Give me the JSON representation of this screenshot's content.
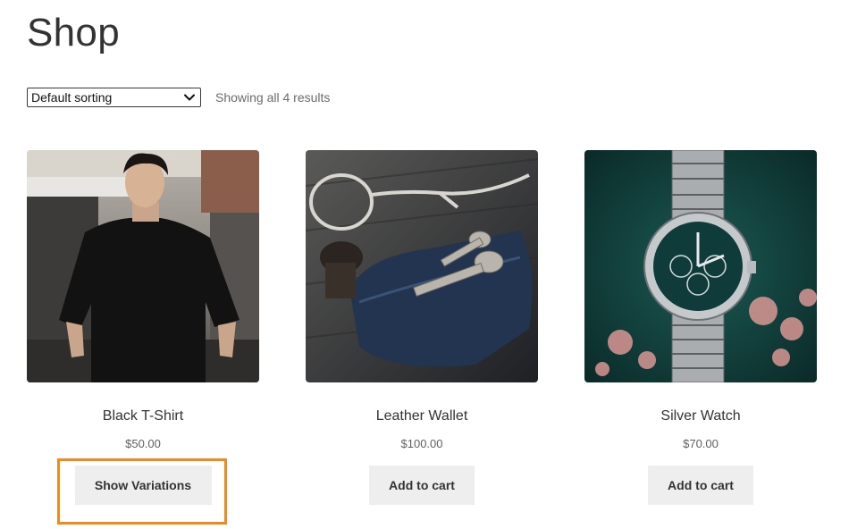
{
  "page": {
    "title": "Shop"
  },
  "toolbar": {
    "sort_selected": "Default sorting",
    "result_count": "Showing all 4 results"
  },
  "products": [
    {
      "name": "Black T-Shirt",
      "price": "$50.00",
      "button_label": "Show Variations"
    },
    {
      "name": "Leather Wallet",
      "price": "$100.00",
      "button_label": "Add to cart"
    },
    {
      "name": "Silver Watch",
      "price": "$70.00",
      "button_label": "Add to cart"
    }
  ],
  "colors": {
    "highlight": "#f08a1c",
    "button_bg": "#eeeeee",
    "text": "#333333"
  },
  "icons": {
    "select": "chevron-down-icon"
  }
}
